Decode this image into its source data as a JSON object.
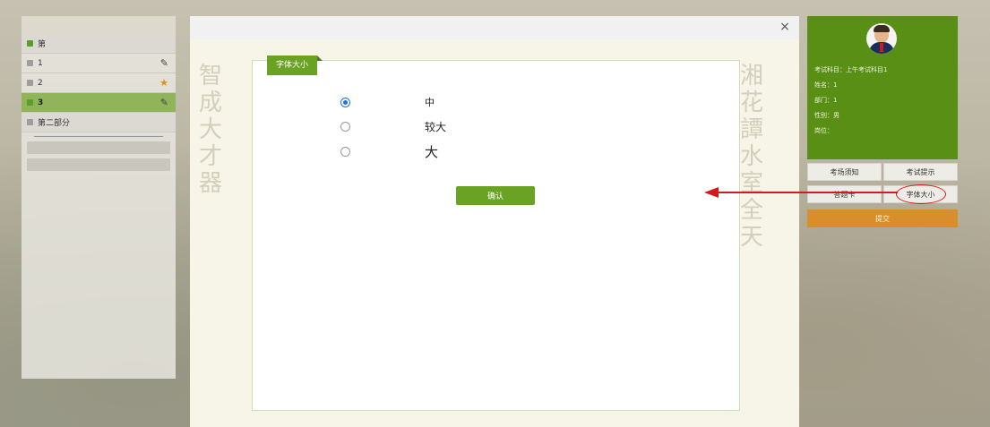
{
  "sidebar": {
    "items": [
      {
        "label": "第",
        "marker": "",
        "state": "section"
      },
      {
        "label": "1",
        "marker": "✎",
        "state": "normal"
      },
      {
        "label": "2",
        "marker": "★",
        "state": "normal"
      },
      {
        "label": "3",
        "marker": "✎",
        "state": "active"
      },
      {
        "label": "第二部分",
        "marker": "",
        "state": "section"
      }
    ]
  },
  "modal": {
    "close_glyph": "×",
    "tab_label": "字体大小",
    "options": [
      {
        "label": "中",
        "checked": true
      },
      {
        "label": "较大",
        "checked": false
      },
      {
        "label": "大",
        "checked": false
      }
    ],
    "confirm_label": "确认",
    "calligraphy_left": [
      "智",
      "成",
      "大",
      "才",
      "器"
    ],
    "calligraphy_right": [
      "湘",
      "花",
      "譚",
      "水",
      "室",
      "全",
      "天"
    ]
  },
  "profile": {
    "subject": "考试科目：上午考试科目1",
    "name": "姓名：1",
    "department": "部门：1",
    "gender": "性别：男",
    "job": "岗位："
  },
  "actions": {
    "exam_notice": "考场须知",
    "exam_tips": "考试提示",
    "answer_sheet": "答题卡",
    "font_size": "字体大小",
    "submit": "提交"
  },
  "colors": {
    "accent_green": "#6aa223",
    "profile_green": "#5a8f16",
    "submit_orange": "#d88f2b",
    "annotation_red": "#d11c1c",
    "radio_blue": "#1a73e8"
  }
}
